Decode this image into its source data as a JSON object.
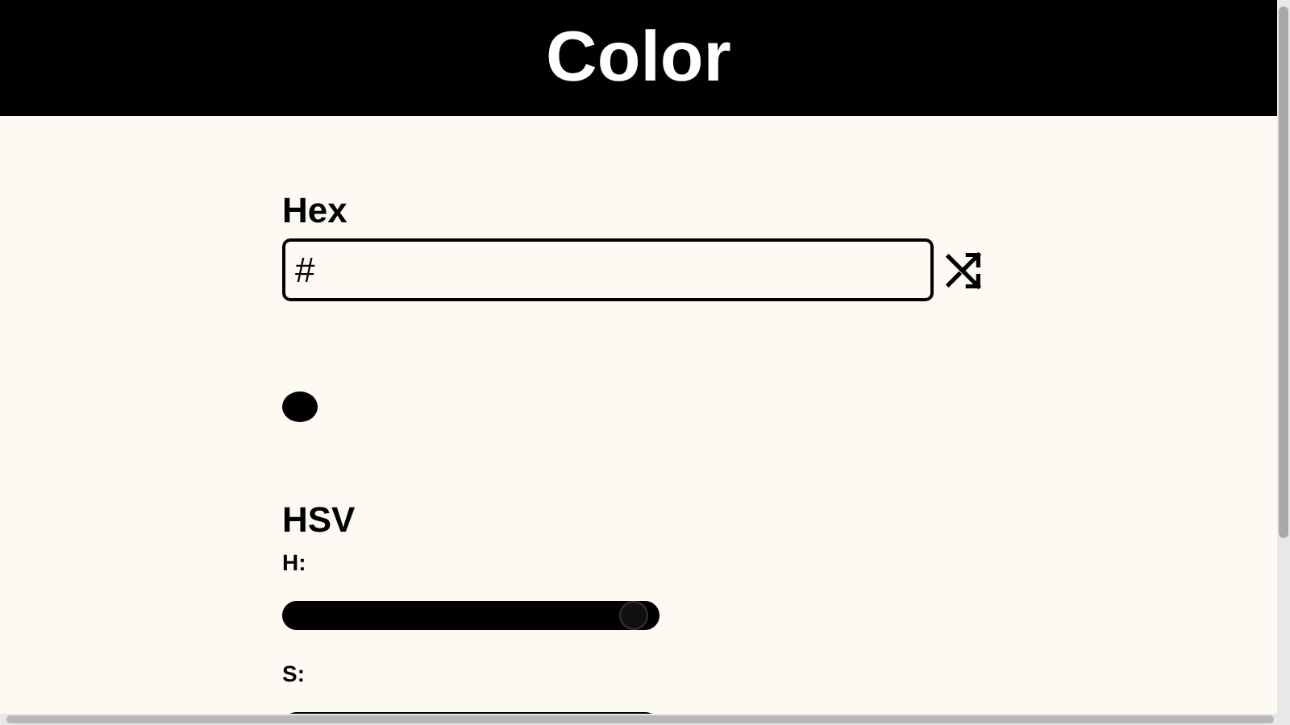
{
  "header": {
    "title": "Color"
  },
  "hex": {
    "label": "Hex",
    "value": "#"
  },
  "swatch": {
    "color": "#000000"
  },
  "hsv": {
    "title": "HSV",
    "sliders": [
      {
        "label": "H:",
        "level": 0.93
      },
      {
        "label": "S:"
      }
    ]
  }
}
